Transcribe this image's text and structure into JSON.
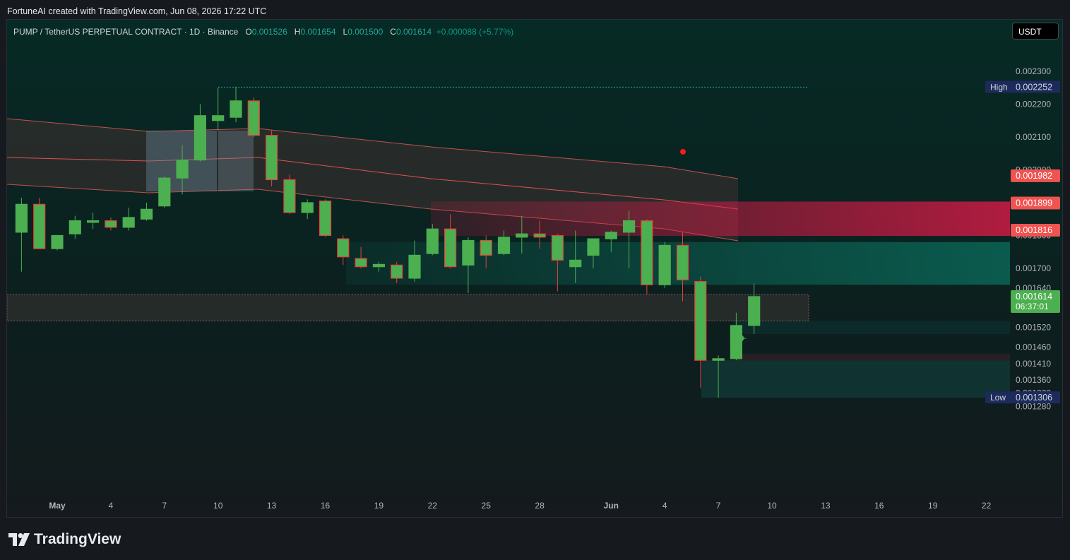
{
  "attribution": "FortuneAI created with TradingView.com, Jun 08, 2026 17:22 UTC",
  "legend": {
    "symbol": "PUMP / TetherUS PERPETUAL CONTRACT · 1D · Binance",
    "o_label": "O",
    "o": "0.001526",
    "h_label": "H",
    "h": "0.001654",
    "l_label": "L",
    "l": "0.001500",
    "c_label": "C",
    "c": "0.001614",
    "change": "+0.000088 (+5.77%)"
  },
  "currency_button": "USDT",
  "brand": "TradingView",
  "colors": {
    "up": "#4caf50",
    "down": "#e6403b",
    "background": "#0f1a1b",
    "band_fill": "#3a3030",
    "red_zone": "#e8194a",
    "green_zone": "#0b8a74",
    "high_label_bg": "#1c2b5c",
    "price_label_red": "#f05350",
    "price_label_green": "#4caf50"
  },
  "chart_data": {
    "type": "candlestick",
    "symbol": "PUMP / TetherUS PERPETUAL CONTRACT",
    "interval": "1D",
    "exchange": "Binance",
    "y_axis_ticks": [
      "0.002300",
      "0.002200",
      "0.002100",
      "0.002000",
      "0.001800",
      "0.001700",
      "0.001640",
      "0.001520",
      "0.001460",
      "0.001410",
      "0.001360",
      "0.001320",
      "0.001280"
    ],
    "y_axis_ticks_values": [
      0.0023,
      0.0022,
      0.0021,
      0.002,
      0.0018,
      0.0017,
      0.00164,
      0.00152,
      0.00146,
      0.00141,
      0.00136,
      0.00132,
      0.00128
    ],
    "x_axis_ticks": [
      {
        "label": "May",
        "day": 0
      },
      {
        "label": "4",
        "day": 3
      },
      {
        "label": "7",
        "day": 6
      },
      {
        "label": "10",
        "day": 9
      },
      {
        "label": "13",
        "day": 12
      },
      {
        "label": "16",
        "day": 15
      },
      {
        "label": "19",
        "day": 18
      },
      {
        "label": "22",
        "day": 21
      },
      {
        "label": "25",
        "day": 24
      },
      {
        "label": "28",
        "day": 27
      },
      {
        "label": "Jun",
        "day": 31
      },
      {
        "label": "4",
        "day": 34
      },
      {
        "label": "7",
        "day": 37
      },
      {
        "label": "10",
        "day": 40
      },
      {
        "label": "13",
        "day": 43
      },
      {
        "label": "16",
        "day": 46
      },
      {
        "label": "19",
        "day": 49
      },
      {
        "label": "22",
        "day": 52
      }
    ],
    "candles": [
      {
        "d": -2,
        "o": 0.00181,
        "h": 0.001915,
        "l": 0.00169,
        "c": 0.001895
      },
      {
        "d": -1,
        "o": 0.001895,
        "h": 0.001915,
        "l": 0.00176,
        "c": 0.00176
      },
      {
        "d": 0,
        "o": 0.00176,
        "h": 0.001775,
        "l": 0.001755,
        "c": 0.0018
      },
      {
        "d": 1,
        "o": 0.001805,
        "h": 0.00186,
        "l": 0.00179,
        "c": 0.001845
      },
      {
        "d": 2,
        "o": 0.00184,
        "h": 0.00187,
        "l": 0.00182,
        "c": 0.001845
      },
      {
        "d": 3,
        "o": 0.001845,
        "h": 0.001855,
        "l": 0.001815,
        "c": 0.001825
      },
      {
        "d": 4,
        "o": 0.001825,
        "h": 0.001885,
        "l": 0.001815,
        "c": 0.001855
      },
      {
        "d": 5,
        "o": 0.00185,
        "h": 0.0019,
        "l": 0.001845,
        "c": 0.00188
      },
      {
        "d": 6,
        "o": 0.00189,
        "h": 0.00198,
        "l": 0.001885,
        "c": 0.001975
      },
      {
        "d": 7,
        "o": 0.001975,
        "h": 0.002075,
        "l": 0.001925,
        "c": 0.00203
      },
      {
        "d": 8,
        "o": 0.00203,
        "h": 0.0022,
        "l": 0.002025,
        "c": 0.002165
      },
      {
        "d": 9,
        "o": 0.00215,
        "h": 0.00225,
        "l": 0.00212,
        "c": 0.002165
      },
      {
        "d": 10,
        "o": 0.00216,
        "h": 0.002252,
        "l": 0.002145,
        "c": 0.00221
      },
      {
        "d": 11,
        "o": 0.00221,
        "h": 0.00222,
        "l": 0.0021,
        "c": 0.002105
      },
      {
        "d": 12,
        "o": 0.002105,
        "h": 0.00212,
        "l": 0.00195,
        "c": 0.00197
      },
      {
        "d": 13,
        "o": 0.00197,
        "h": 0.001985,
        "l": 0.001865,
        "c": 0.00187
      },
      {
        "d": 14,
        "o": 0.00187,
        "h": 0.00191,
        "l": 0.00185,
        "c": 0.0019
      },
      {
        "d": 15,
        "o": 0.001905,
        "h": 0.00191,
        "l": 0.001795,
        "c": 0.0018
      },
      {
        "d": 16,
        "o": 0.00179,
        "h": 0.0018,
        "l": 0.00171,
        "c": 0.001735
      },
      {
        "d": 17,
        "o": 0.00173,
        "h": 0.001765,
        "l": 0.0017,
        "c": 0.001705
      },
      {
        "d": 18,
        "o": 0.001705,
        "h": 0.00172,
        "l": 0.00169,
        "c": 0.001712
      },
      {
        "d": 19,
        "o": 0.00171,
        "h": 0.00172,
        "l": 0.001655,
        "c": 0.00167
      },
      {
        "d": 20,
        "o": 0.00167,
        "h": 0.001785,
        "l": 0.00166,
        "c": 0.00174
      },
      {
        "d": 21,
        "o": 0.001745,
        "h": 0.001835,
        "l": 0.00174,
        "c": 0.00182
      },
      {
        "d": 22,
        "o": 0.00182,
        "h": 0.001865,
        "l": 0.0017,
        "c": 0.001705
      },
      {
        "d": 23,
        "o": 0.00171,
        "h": 0.001795,
        "l": 0.001625,
        "c": 0.001785
      },
      {
        "d": 24,
        "o": 0.001785,
        "h": 0.0018,
        "l": 0.0017,
        "c": 0.00174
      },
      {
        "d": 25,
        "o": 0.001745,
        "h": 0.001815,
        "l": 0.00174,
        "c": 0.001795
      },
      {
        "d": 26,
        "o": 0.001795,
        "h": 0.00186,
        "l": 0.001745,
        "c": 0.001805
      },
      {
        "d": 27,
        "o": 0.001805,
        "h": 0.001845,
        "l": 0.00176,
        "c": 0.001795
      },
      {
        "d": 28,
        "o": 0.0018,
        "h": 0.001805,
        "l": 0.00163,
        "c": 0.001725
      },
      {
        "d": 29,
        "o": 0.001705,
        "h": 0.001815,
        "l": 0.001655,
        "c": 0.001725
      },
      {
        "d": 30,
        "o": 0.00174,
        "h": 0.001785,
        "l": 0.0017,
        "c": 0.00179
      },
      {
        "d": 31,
        "o": 0.00179,
        "h": 0.001815,
        "l": 0.00175,
        "c": 0.00181
      },
      {
        "d": 32,
        "o": 0.00181,
        "h": 0.001875,
        "l": 0.0017,
        "c": 0.001845
      },
      {
        "d": 33,
        "o": 0.001845,
        "h": 0.00185,
        "l": 0.00162,
        "c": 0.00165
      },
      {
        "d": 34,
        "o": 0.00165,
        "h": 0.00178,
        "l": 0.00164,
        "c": 0.00177
      },
      {
        "d": 35,
        "o": 0.00177,
        "h": 0.00181,
        "l": 0.0016,
        "c": 0.001665
      },
      {
        "d": 36,
        "o": 0.00166,
        "h": 0.001675,
        "l": 0.001335,
        "c": 0.00142
      },
      {
        "d": 37,
        "o": 0.00142,
        "h": 0.001435,
        "l": 0.001306,
        "c": 0.001425
      },
      {
        "d": 38,
        "o": 0.001425,
        "h": 0.001565,
        "l": 0.00142,
        "c": 0.001526
      },
      {
        "d": 39,
        "o": 0.001526,
        "h": 0.001654,
        "l": 0.0015,
        "c": 0.001614
      }
    ],
    "price_labels": [
      {
        "text": "0.001982",
        "value": 0.001982,
        "kind": "red"
      },
      {
        "text": "0.001899",
        "value": 0.001899,
        "kind": "red"
      },
      {
        "text": "0.001816",
        "value": 0.001816,
        "kind": "red"
      },
      {
        "text": "0.001614",
        "value": 0.001614,
        "kind": "green",
        "sub": "06:37:01"
      }
    ],
    "high": {
      "label": "High",
      "value": 0.002252,
      "text": "0.002252"
    },
    "low": {
      "label": "Low",
      "value": 0.001306,
      "text": "0.001306"
    }
  }
}
